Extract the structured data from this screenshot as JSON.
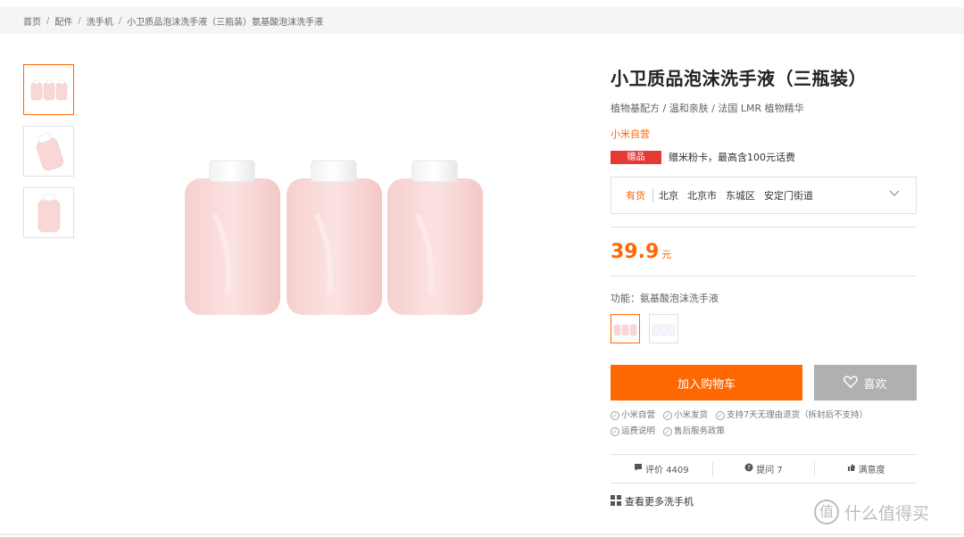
{
  "breadcrumb": {
    "items": [
      "首页",
      "配件",
      "洗手机",
      "小卫质品泡沫洗手液（三瓶装）氨基酸泡沫洗手液"
    ],
    "separator": "/"
  },
  "product": {
    "title": "小卫质品泡沫洗手液（三瓶装）",
    "subtitle": "植物基配方 / 温和亲肤 / 法国 LMR 植物精华",
    "self_operated": "小米自营",
    "gift_tag": "赠品",
    "gift_text": "赠米粉卡，最高含100元话费"
  },
  "address": {
    "stock": "有货",
    "locations": [
      "北京",
      "北京市",
      "东城区",
      "安定门街道"
    ]
  },
  "price": {
    "value": "39.9",
    "unit": "元"
  },
  "feature": {
    "label": "功能：氨基酸泡沫洗手液"
  },
  "actions": {
    "cart_label": "加入购物车",
    "like_label": "喜欢"
  },
  "services": [
    "小米自营",
    "小米发货",
    "支持7天无理由退货（拆封后不支持）",
    "运费说明",
    "售后服务政策"
  ],
  "reviews": {
    "comments": "评价 4409",
    "questions": "提问 7",
    "satisfaction": "满意度"
  },
  "more": {
    "label": "查看更多洗手机"
  },
  "watermark": {
    "text": "什么值得买",
    "glyph": "值"
  },
  "colors": {
    "accent": "#ff6700",
    "gift": "#e53935",
    "bottle": "#f8d7d6"
  }
}
